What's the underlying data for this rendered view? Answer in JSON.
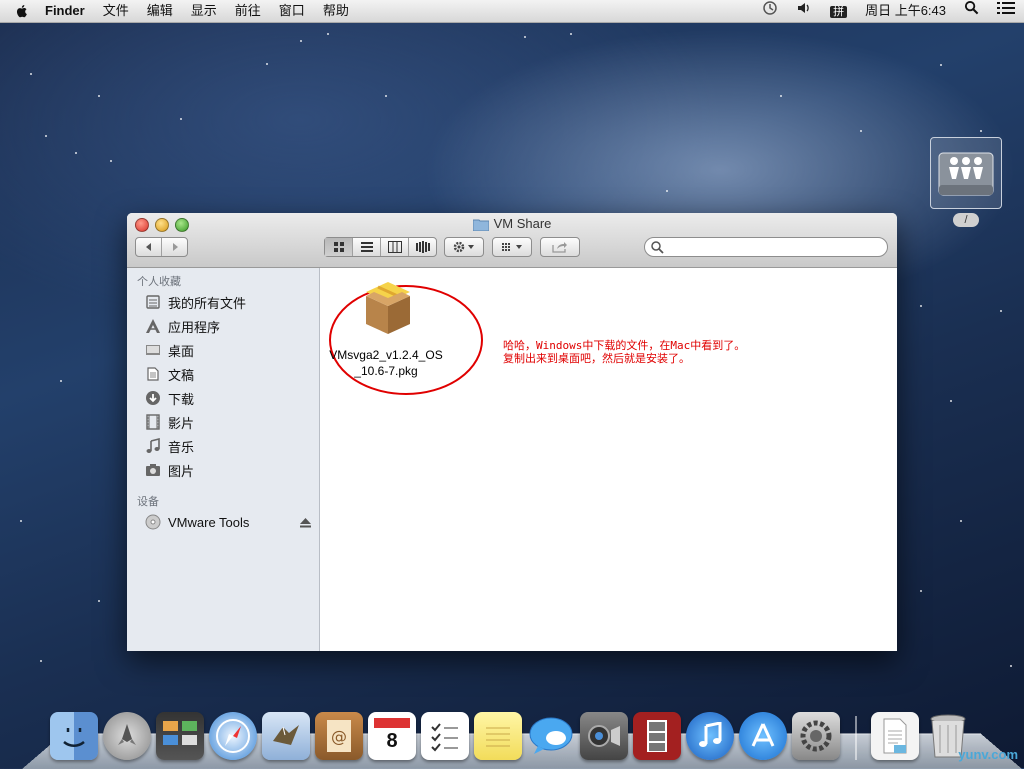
{
  "menubar": {
    "app_name": "Finder",
    "items": [
      "文件",
      "编辑",
      "显示",
      "前往",
      "窗口",
      "帮助"
    ],
    "ime_label": "拼",
    "clock": "周日 上午6:43"
  },
  "desktop": {
    "drive_label": "/"
  },
  "window": {
    "title": "VM Share",
    "search_placeholder": "",
    "sidebar": {
      "favorites_header": "个人收藏",
      "favorites": [
        {
          "label": "我的所有文件",
          "icon": "all-files-icon"
        },
        {
          "label": "应用程序",
          "icon": "applications-icon"
        },
        {
          "label": "桌面",
          "icon": "desktop-icon"
        },
        {
          "label": "文稿",
          "icon": "documents-icon"
        },
        {
          "label": "下载",
          "icon": "downloads-icon"
        },
        {
          "label": "影片",
          "icon": "movies-icon"
        },
        {
          "label": "音乐",
          "icon": "music-icon"
        },
        {
          "label": "图片",
          "icon": "pictures-icon"
        }
      ],
      "devices_header": "设备",
      "devices": [
        {
          "label": "VMware Tools",
          "icon": "disc-icon"
        }
      ]
    },
    "file": {
      "name": "VMsvga2_v1.2.4_OS_10.6-7.pkg",
      "icon": "package-icon"
    },
    "annotation": {
      "line1": "哈哈，Windows中下载的文件，在Mac中看到了。",
      "line2": "复制出来到桌面吧，然后就是安装了。"
    }
  },
  "dock": {
    "apps": [
      "Finder",
      "Launchpad",
      "Mission Control",
      "Safari",
      "Mail",
      "Contacts",
      "Calendar",
      "Reminders",
      "Notes",
      "Messages",
      "FaceTime",
      "Photo Booth",
      "iTunes",
      "App Store",
      "System Preferences",
      "Documents",
      "Trash"
    ],
    "calendar_day": "8"
  },
  "watermark": "yunv.com",
  "colors": {
    "annotation": "#e00000",
    "sidebar_bg": "#e6eaf0"
  }
}
